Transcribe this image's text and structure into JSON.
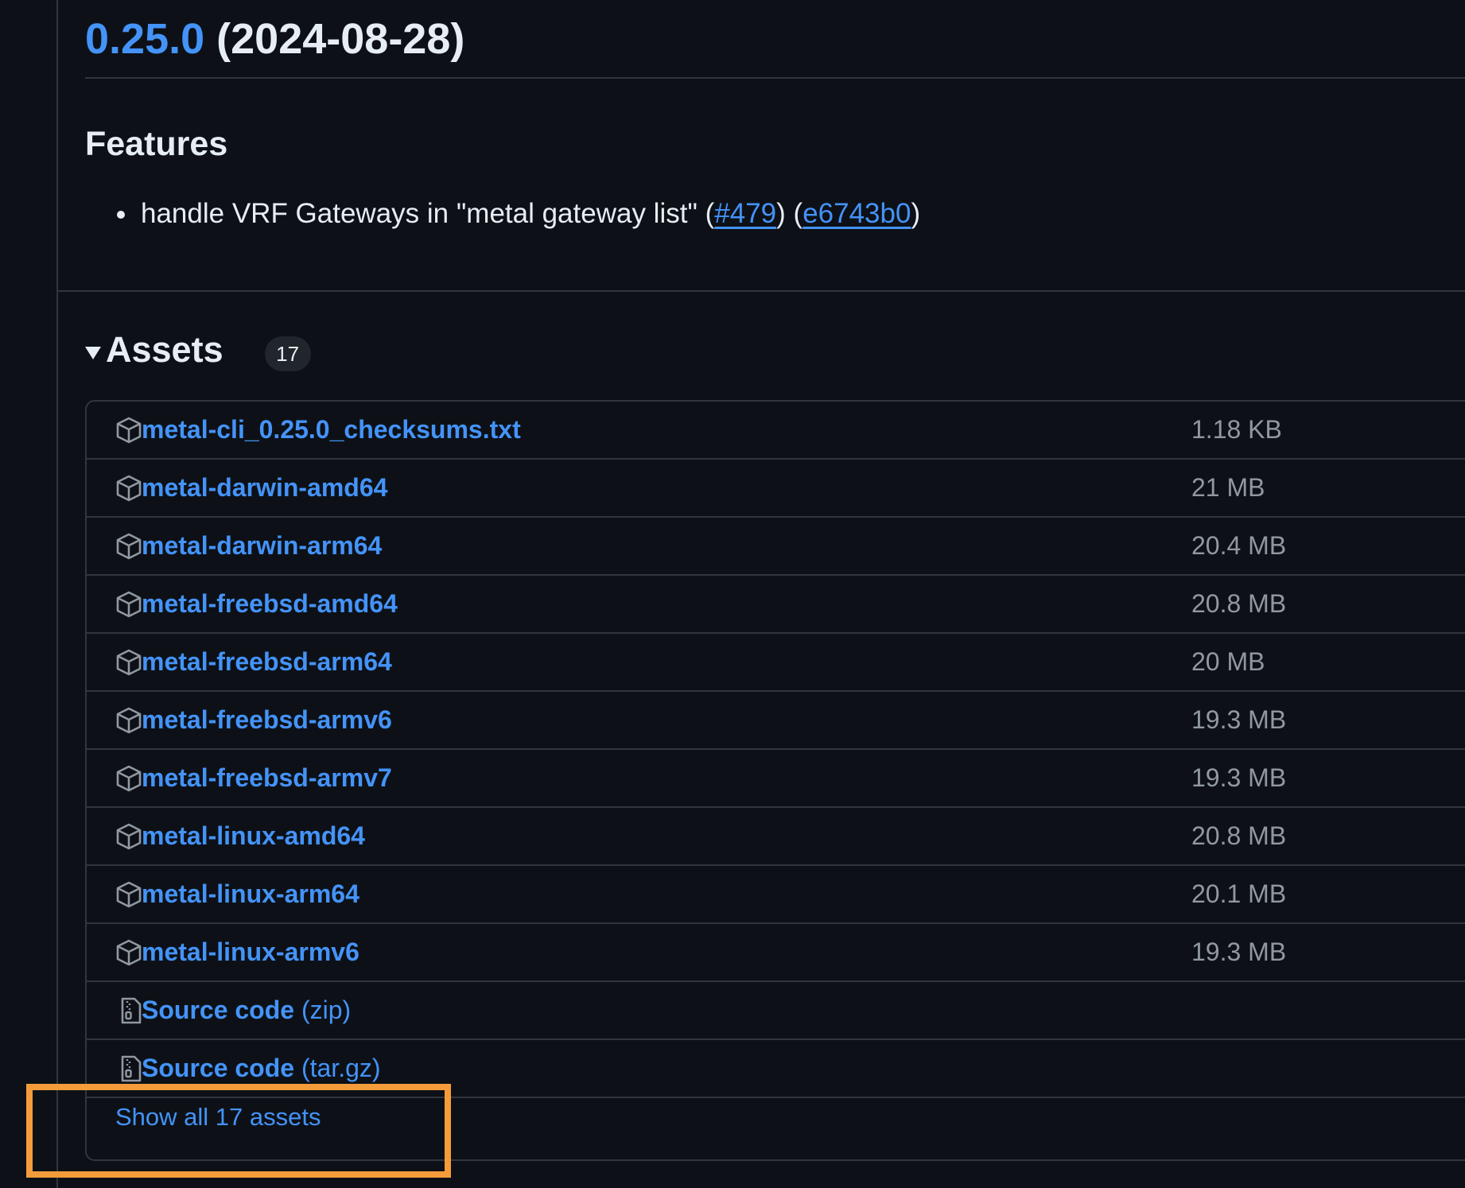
{
  "release": {
    "version": "0.25.0",
    "date": "(2024-08-28)"
  },
  "features": {
    "heading": "Features",
    "items": [
      {
        "text_before": "handle VRF Gateways in \"metal gateway list\" (",
        "pr_link": "#479",
        "text_middle": ") (",
        "commit_link": "e6743b0",
        "text_after": ")"
      }
    ]
  },
  "assets": {
    "title": "Assets",
    "count": "17",
    "list": [
      {
        "name": "metal-cli_0.25.0_checksums.txt",
        "size": "1.18 KB",
        "icon": "package-icon"
      },
      {
        "name": "metal-darwin-amd64",
        "size": "21 MB",
        "icon": "package-icon"
      },
      {
        "name": "metal-darwin-arm64",
        "size": "20.4 MB",
        "icon": "package-icon"
      },
      {
        "name": "metal-freebsd-amd64",
        "size": "20.8 MB",
        "icon": "package-icon"
      },
      {
        "name": "metal-freebsd-arm64",
        "size": "20 MB",
        "icon": "package-icon"
      },
      {
        "name": "metal-freebsd-armv6",
        "size": "19.3 MB",
        "icon": "package-icon"
      },
      {
        "name": "metal-freebsd-armv7",
        "size": "19.3 MB",
        "icon": "package-icon"
      },
      {
        "name": "metal-linux-amd64",
        "size": "20.8 MB",
        "icon": "package-icon"
      },
      {
        "name": "metal-linux-arm64",
        "size": "20.1 MB",
        "icon": "package-icon"
      },
      {
        "name": "metal-linux-armv6",
        "size": "19.3 MB",
        "icon": "package-icon"
      }
    ],
    "source_code": [
      {
        "name": "Source code",
        "suffix": "(zip)",
        "icon": "file-zip-icon"
      },
      {
        "name": "Source code",
        "suffix": "(tar.gz)",
        "icon": "file-zip-icon"
      }
    ],
    "show_all": "Show all 17 assets"
  },
  "colors": {
    "background": "#0d1117",
    "link": "#4493f8",
    "border": "#30363d",
    "muted_text": "#9198a1",
    "highlight": "#f49c3b"
  }
}
